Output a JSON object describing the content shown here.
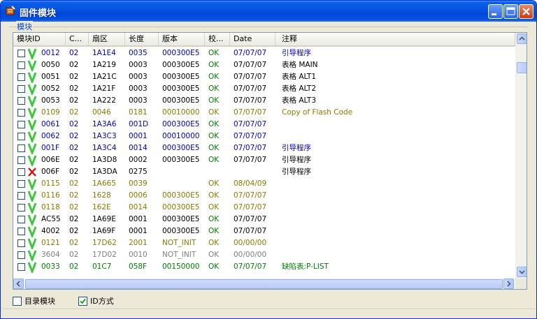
{
  "window": {
    "title": "固件模块",
    "colors": {
      "titlebar": "#0553e0",
      "chrome": "#ece9d8"
    }
  },
  "group": {
    "label": "模块"
  },
  "columns": [
    "模块ID",
    "C...",
    "扇区",
    "长度",
    "版本",
    "校...",
    "Date",
    "注释"
  ],
  "rows": [
    {
      "status": "ok",
      "color": "blue",
      "id": "0012",
      "c": "02",
      "sector": "1A1E4",
      "length": "0035",
      "version": "000300E5",
      "check": "OK",
      "date": "07/07/07",
      "comment": "引导程序"
    },
    {
      "status": "ok",
      "color": "black",
      "id": "0050",
      "c": "02",
      "sector": "1A219",
      "length": "0003",
      "version": "000300E5",
      "check": "OK",
      "date": "07/07/07",
      "comment": "表格 MAIN"
    },
    {
      "status": "ok",
      "color": "black",
      "id": "0051",
      "c": "02",
      "sector": "1A21C",
      "length": "0003",
      "version": "000300E5",
      "check": "OK",
      "date": "07/07/07",
      "comment": "表格 ALT1"
    },
    {
      "status": "ok",
      "color": "black",
      "id": "0052",
      "c": "02",
      "sector": "1A21F",
      "length": "0003",
      "version": "000300E5",
      "check": "OK",
      "date": "07/07/07",
      "comment": "表格 ALT2"
    },
    {
      "status": "ok",
      "color": "black",
      "id": "0053",
      "c": "02",
      "sector": "1A222",
      "length": "0003",
      "version": "000300E5",
      "check": "OK",
      "date": "07/07/07",
      "comment": "表格 ALT3"
    },
    {
      "status": "ok",
      "color": "olive",
      "id": "0109",
      "c": "02",
      "sector": "0046",
      "length": "0181",
      "version": "00010000",
      "check": "OK",
      "date": "07/07/07",
      "comment": "Copy of Flash Code"
    },
    {
      "status": "ok",
      "color": "blue",
      "id": "0061",
      "c": "02",
      "sector": "1A3A6",
      "length": "001D",
      "version": "000300E5",
      "check": "OK",
      "date": "07/07/07",
      "comment": ""
    },
    {
      "status": "ok",
      "color": "blue",
      "id": "0062",
      "c": "02",
      "sector": "1A3C3",
      "length": "0001",
      "version": "00010000",
      "check": "OK",
      "date": "07/07/07",
      "comment": ""
    },
    {
      "status": "ok",
      "color": "blue",
      "id": "001F",
      "c": "02",
      "sector": "1A3C4",
      "length": "0014",
      "version": "000300E5",
      "check": "OK",
      "date": "07/07/07",
      "comment": "引导程序"
    },
    {
      "status": "ok",
      "color": "black",
      "id": "006E",
      "c": "02",
      "sector": "1A3D8",
      "length": "0002",
      "version": "000300E5",
      "check": "OK",
      "date": "07/07/07",
      "comment": "引导程序"
    },
    {
      "status": "bad",
      "color": "black",
      "id": "006F",
      "c": "02",
      "sector": "1A3DA",
      "length": "0275",
      "version": "",
      "check": "",
      "date": "",
      "comment": "引导程序"
    },
    {
      "status": "ok",
      "color": "olive",
      "id": "0115",
      "c": "02",
      "sector": "1A665",
      "length": "0039",
      "version": "",
      "check": "OK",
      "date": "08/04/09",
      "comment": ""
    },
    {
      "status": "ok",
      "color": "olive",
      "id": "0116",
      "c": "02",
      "sector": "1628",
      "length": "0006",
      "version": "000300E5",
      "check": "OK",
      "date": "07/07/07",
      "comment": ""
    },
    {
      "status": "ok",
      "color": "olive",
      "id": "0118",
      "c": "02",
      "sector": "162E",
      "length": "0014",
      "version": "000300E5",
      "check": "OK",
      "date": "07/07/07",
      "comment": ""
    },
    {
      "status": "ok",
      "color": "black",
      "id": "AC55",
      "c": "02",
      "sector": "1A69E",
      "length": "0001",
      "version": "000300E5",
      "check": "OK",
      "date": "07/07/07",
      "comment": ""
    },
    {
      "status": "ok",
      "color": "black",
      "id": "4002",
      "c": "02",
      "sector": "1A69F",
      "length": "0001",
      "version": "000300E5",
      "check": "OK",
      "date": "07/07/07",
      "comment": ""
    },
    {
      "status": "ok",
      "color": "olive",
      "id": "0121",
      "c": "02",
      "sector": "17D62",
      "length": "2001",
      "version": "NOT_INIT",
      "check": "OK",
      "date": "00/00/00",
      "comment": ""
    },
    {
      "status": "ok",
      "color": "gray",
      "id": "3604",
      "c": "02",
      "sector": "17D02",
      "length": "0010",
      "version": "NOT_INIT",
      "check": "OK",
      "date": "00/00/00",
      "comment": ""
    },
    {
      "status": "ok",
      "color": "green",
      "id": "0033",
      "c": "02",
      "sector": "01C7",
      "length": "058F",
      "version": "00150000",
      "check": "OK",
      "date": "07/07/07",
      "comment": "缺陷表:P-LIST"
    }
  ],
  "options": [
    {
      "label": "目录模块",
      "checked": false
    },
    {
      "label": "ID方式",
      "checked": true
    }
  ],
  "palette": {
    "blue": "#0000c8",
    "black": "#000000",
    "olive": "#8a7a00",
    "gray": "#808080",
    "green": "#008000",
    "okGreen": "#008000",
    "checkMark": "#3cc83c",
    "badMark": "#e00000"
  }
}
